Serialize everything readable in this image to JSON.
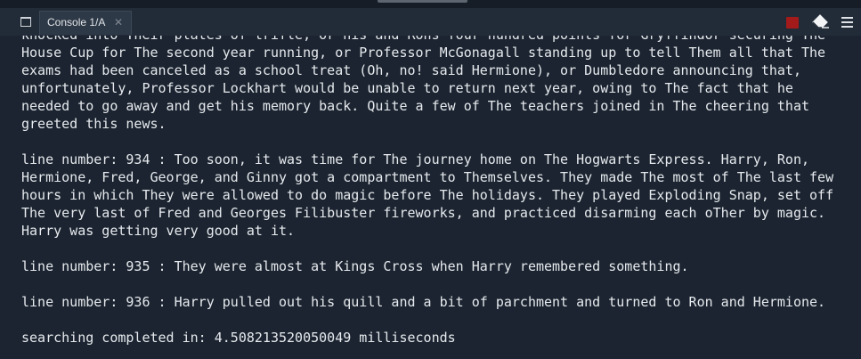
{
  "tab": {
    "label": "Console 1/A",
    "close_glyph": "✕"
  },
  "toolbar": {
    "pane_icon": "pane-icon",
    "stop_icon": "stop-square-icon",
    "clear_icon": "eraser-icon",
    "menu_icon": "hamburger-menu-icon",
    "stop_color": "#a31a1a"
  },
  "console": {
    "lines": [
      "knocked into Their plates of trifle, or his and Rons four hundred points for Gryffindor securing The",
      "House Cup for The second year running, or Professor McGonagall standing up to tell Them all that The",
      "exams had been canceled as a school treat (Oh, no! said Hermione), or Dumbledore announcing that,",
      "unfortunately, Professor Lockhart would be unable to return next year, owing to The fact that he",
      "needed to go away and get his memory back. Quite a few of The teachers joined in The cheering that",
      "greeted this news.",
      "",
      "line number: 934 : Too soon, it was time for The journey home on The Hogwarts Express. Harry, Ron,",
      "Hermione, Fred, George, and Ginny got a compartment to Themselves. They made The most of The last few",
      "hours in which They were allowed to do magic before The holidays. They played Exploding Snap, set off",
      "The very last of Fred and Georges Filibuster fireworks, and practiced disarming each oTher by magic.",
      "Harry was getting very good at it.",
      "",
      "line number: 935 : They were almost at Kings Cross when Harry remembered something.",
      "",
      "line number: 936 : Harry pulled out his quill and a bit of parchment and turned to Ron and Hermione.",
      "",
      "searching completed in: 4.508213520050049 milliseconds"
    ]
  }
}
